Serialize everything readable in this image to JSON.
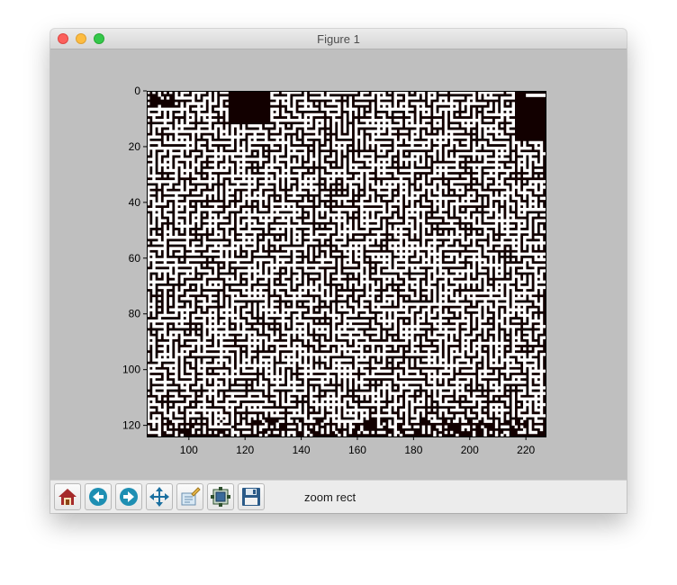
{
  "window": {
    "title": "Figure 1"
  },
  "toolbar": {
    "buttons": [
      {
        "name": "home-button",
        "icon": "home-icon"
      },
      {
        "name": "back-button",
        "icon": "arrow-left-icon"
      },
      {
        "name": "forward-button",
        "icon": "arrow-right-icon"
      },
      {
        "name": "pan-button",
        "icon": "move-arrows-icon"
      },
      {
        "name": "zoom-button",
        "icon": "zoom-rect-icon"
      },
      {
        "name": "subplots-button",
        "icon": "subplots-config-icon"
      },
      {
        "name": "save-button",
        "icon": "floppy-disk-icon"
      }
    ],
    "status_text": "zoom rect"
  },
  "chart_data": {
    "type": "heatmap",
    "description_kind": "binary maze image (imshow)",
    "colors": {
      "wall": "#120000",
      "path": "#ffffff"
    },
    "xlim": [
      85,
      227
    ],
    "ylim": [
      124,
      0
    ],
    "xticks": [
      100,
      120,
      140,
      160,
      180,
      200,
      220
    ],
    "yticks": [
      0,
      20,
      40,
      60,
      80,
      100,
      120
    ],
    "title": "",
    "xlabel": "",
    "ylabel": ""
  }
}
